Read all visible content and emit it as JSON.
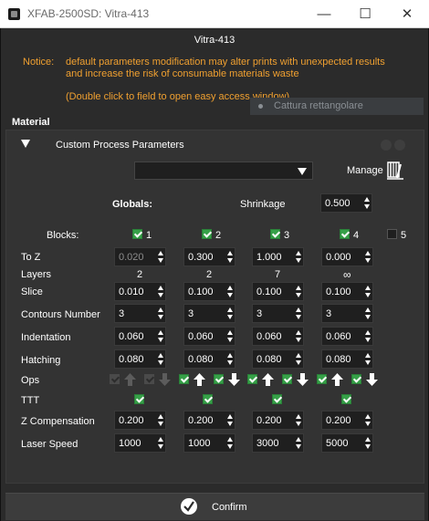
{
  "window": {
    "title": "XFAB-2500SD: Vitra-413",
    "minimize": "—",
    "maximize": "☐",
    "close": "✕"
  },
  "dialog": {
    "title": "Vitra-413"
  },
  "notice": {
    "label": "Notice:",
    "line1": "default parameters modification may alter prints with unexpected results",
    "line2": "and increase the risk of consumable materials waste",
    "hint": "(Double click to field to open easy access window)"
  },
  "ghost_tooltip": "Cattura rettangolare",
  "material": {
    "section_title": "Material",
    "custom_label": "Custom Process Parameters",
    "combo_value": "",
    "manage_label": "Manage",
    "globals_label": "Globals:",
    "shrinkage_label": "Shrinkage",
    "shrinkage_value": "0.500"
  },
  "blocks": {
    "label": "Blocks:",
    "columns": [
      {
        "number": "1",
        "enabled": true
      },
      {
        "number": "2",
        "enabled": true
      },
      {
        "number": "3",
        "enabled": true
      },
      {
        "number": "4",
        "enabled": true
      },
      {
        "number": "5",
        "enabled": false
      }
    ]
  },
  "rows": {
    "to_z": {
      "label": "To Z",
      "values": [
        "0.020",
        "0.300",
        "1.000",
        "0.000"
      ]
    },
    "layers": {
      "label": "Layers",
      "values": [
        "2",
        "2",
        "7",
        "∞"
      ]
    },
    "slice": {
      "label": "Slice",
      "values": [
        "0.010",
        "0.100",
        "0.100",
        "0.100"
      ]
    },
    "contours": {
      "label": "Contours Number",
      "values": [
        "3",
        "3",
        "3",
        "3"
      ]
    },
    "indentation": {
      "label": "Indentation",
      "values": [
        "0.060",
        "0.060",
        "0.060",
        "0.060"
      ]
    },
    "hatching": {
      "label": "Hatching",
      "values": [
        "0.080",
        "0.080",
        "0.080",
        "0.080"
      ]
    },
    "ops": {
      "label": "Ops",
      "block1_enabled": false
    },
    "ttt": {
      "label": "TTT",
      "values": [
        true,
        true,
        true,
        true
      ]
    },
    "z_compensation": {
      "label": "Z Compensation",
      "values": [
        "0.200",
        "0.200",
        "0.200",
        "0.200"
      ]
    },
    "laser_speed": {
      "label": "Laser Speed",
      "values": [
        "1000",
        "1000",
        "3000",
        "5000"
      ]
    }
  },
  "confirm": {
    "label": "Confirm"
  },
  "colors": {
    "accent_green": "#36a048",
    "notice_orange": "#f0a030",
    "background": "#2b2b2b"
  }
}
